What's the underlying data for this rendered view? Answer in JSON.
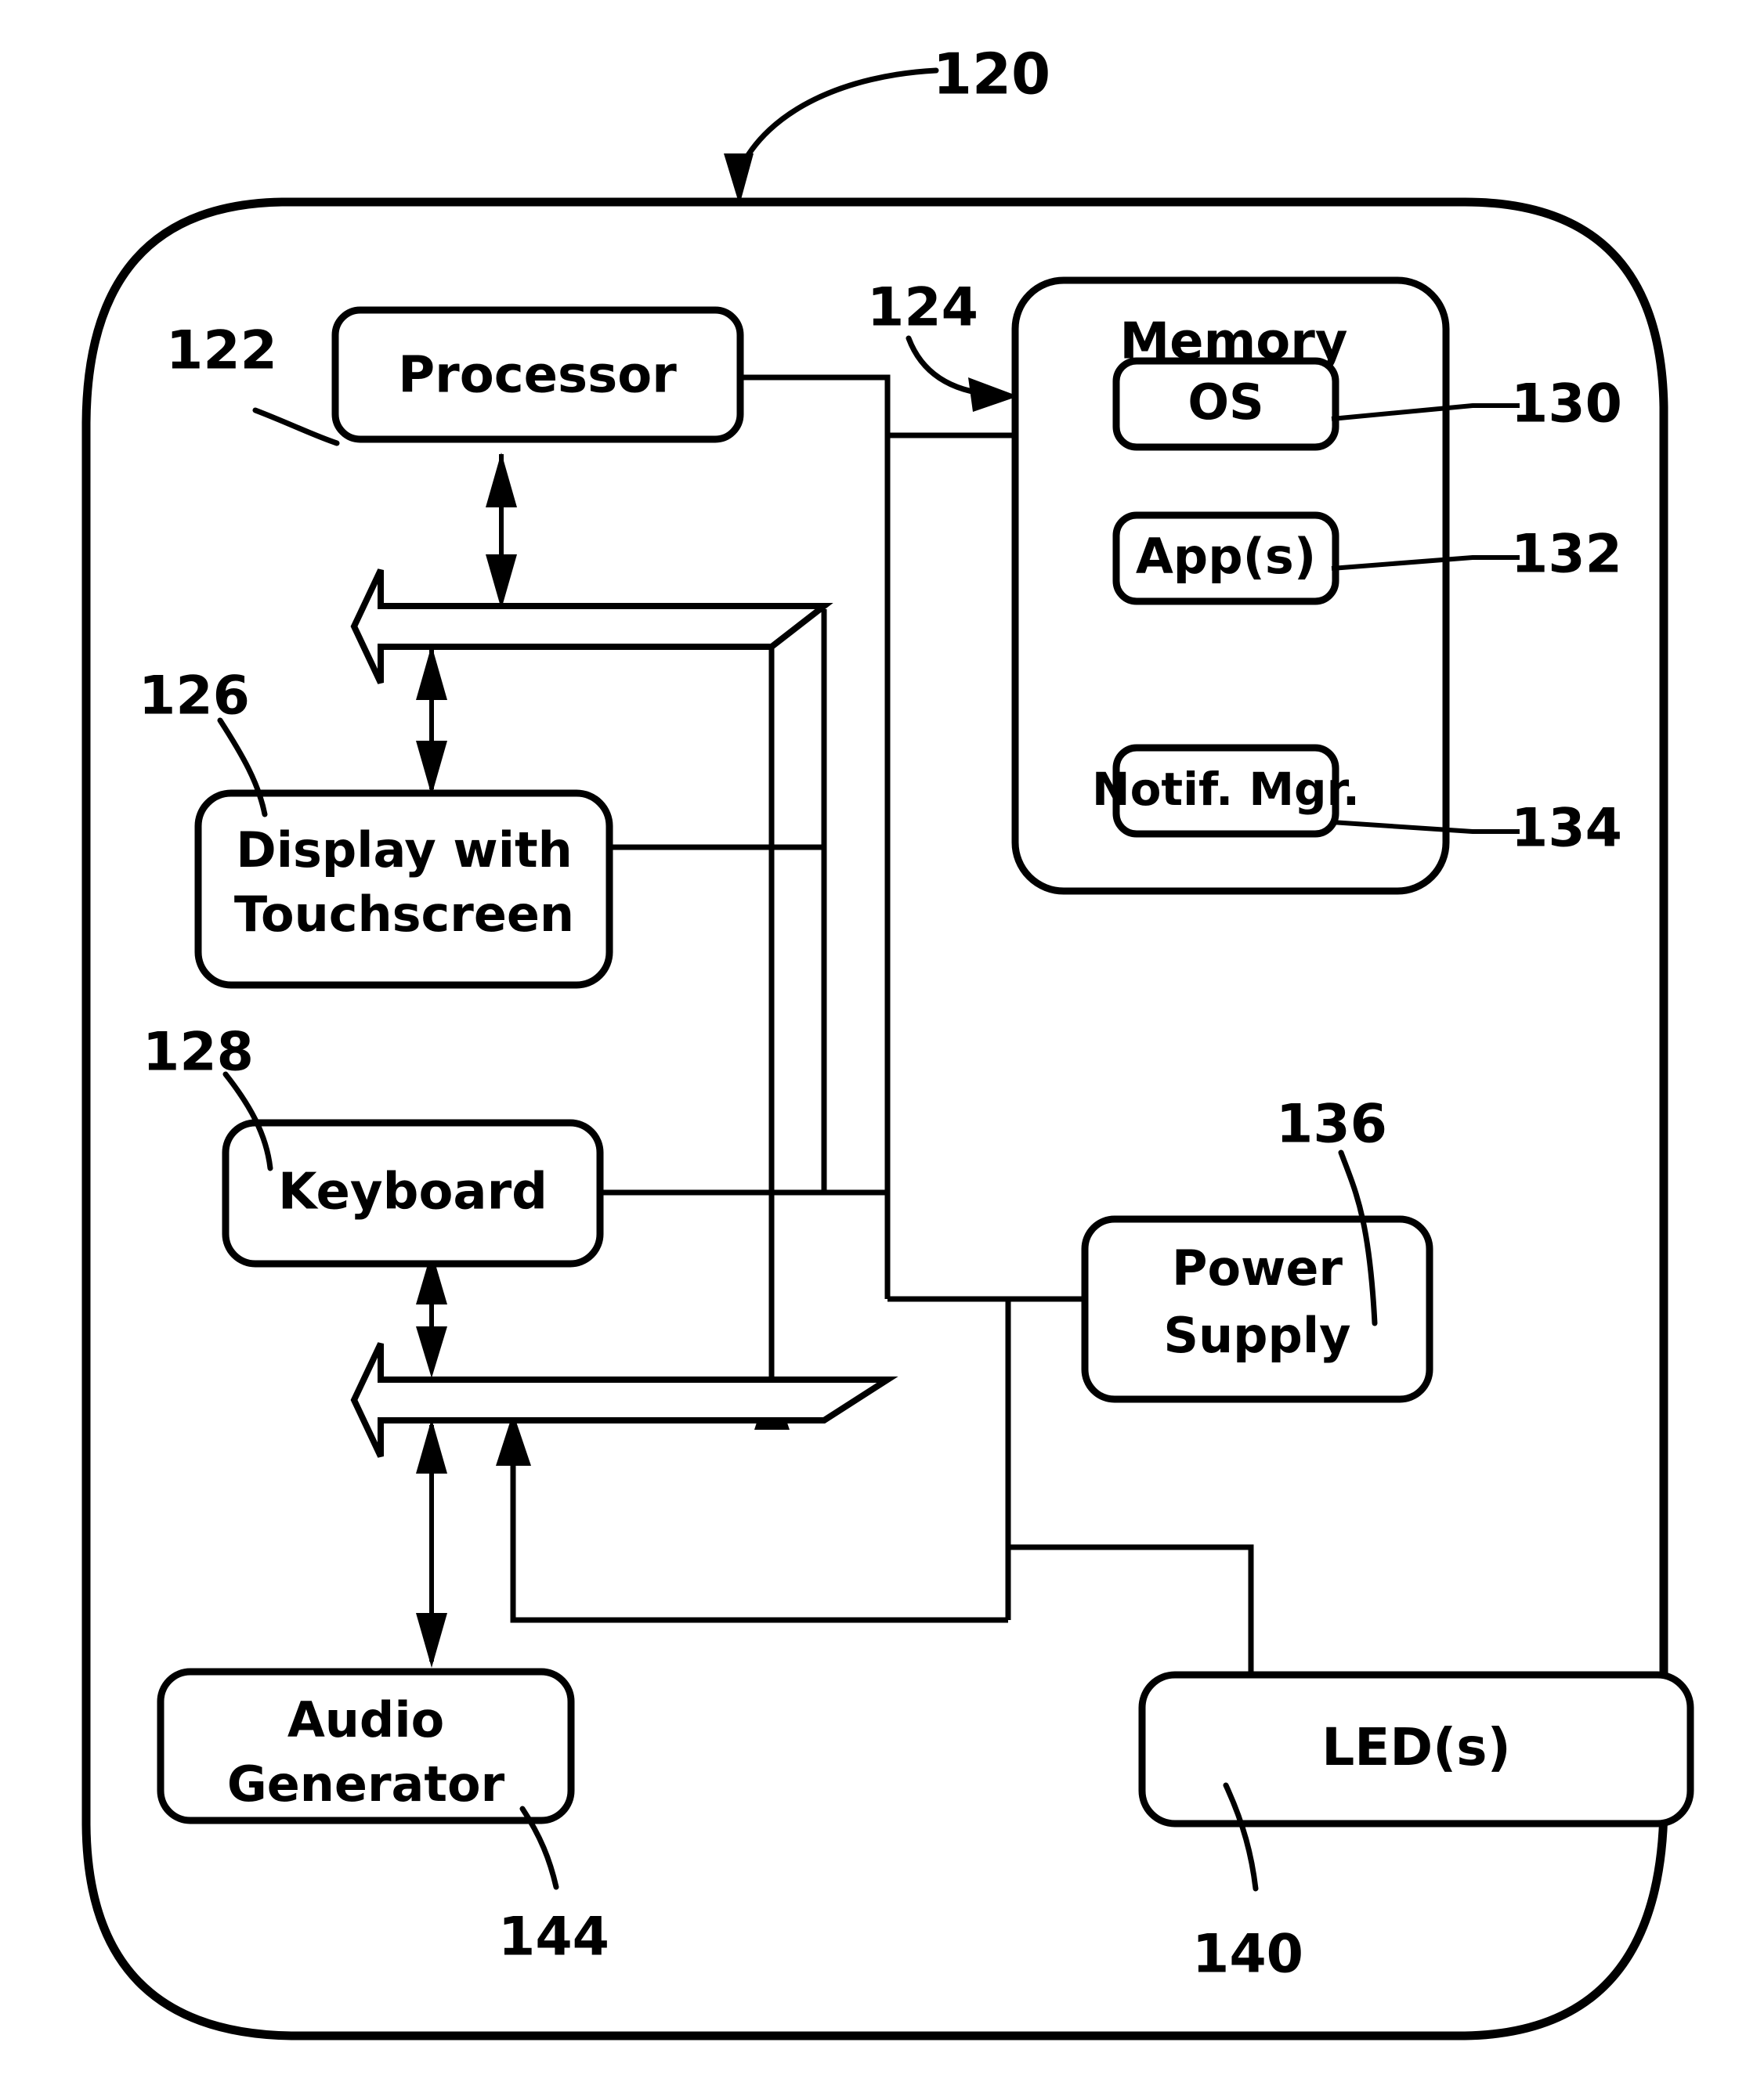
{
  "figure": {
    "type": "patent-block-diagram",
    "background_color": "#ffffff",
    "line_color": "#000000",
    "device_reference_numeral": "120"
  },
  "blocks": {
    "processor": {
      "label": "Processor",
      "ref": "122"
    },
    "memory": {
      "label": "Memory",
      "ref": "124"
    },
    "os": {
      "label": "OS",
      "ref": "130"
    },
    "apps": {
      "label": "App(s)",
      "ref": "132"
    },
    "notif_mgr": {
      "label": "Notif. Mgr.",
      "ref": "134"
    },
    "display": {
      "label_line1": "Display with",
      "label_line2": "Touchscreen",
      "ref": "126"
    },
    "keyboard": {
      "label": "Keyboard",
      "ref": "128"
    },
    "power_supply": {
      "label_line1": "Power",
      "label_line2": "Supply",
      "ref": "136"
    },
    "audio_generator": {
      "label_line1": "Audio",
      "label_line2": "Generator",
      "ref": "144"
    },
    "leds": {
      "label": "LED(s)",
      "ref": "140"
    }
  },
  "reference_numerals": {
    "device": "120",
    "processor": "122",
    "memory": "124",
    "display": "126",
    "keyboard": "128",
    "os": "130",
    "apps": "132",
    "notif_mgr": "134",
    "power_supply": "136",
    "leds": "140",
    "audio_generator": "144"
  }
}
